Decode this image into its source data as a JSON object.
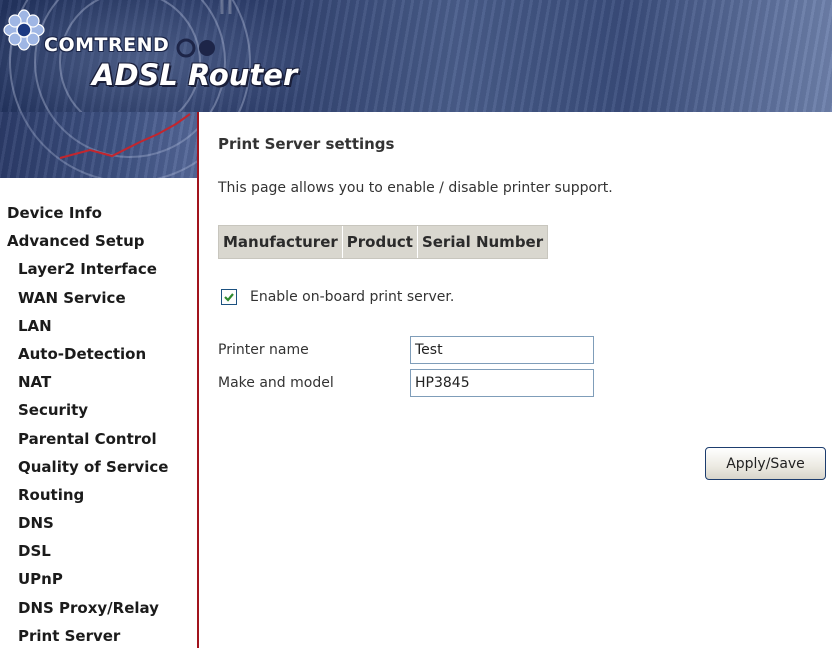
{
  "header": {
    "brand": "COMTREND",
    "product_title": "ADSL Router"
  },
  "colors": {
    "banner": "#2e3f6d",
    "divider": "#a1141d",
    "table_header_bg": "#d9d7cf"
  },
  "nav": {
    "items": [
      {
        "label": "Device Info",
        "level": "top"
      },
      {
        "label": "Advanced Setup",
        "level": "top"
      },
      {
        "label": "Layer2 Interface",
        "level": "sub"
      },
      {
        "label": "WAN Service",
        "level": "sub"
      },
      {
        "label": "LAN",
        "level": "sub"
      },
      {
        "label": "Auto-Detection",
        "level": "sub"
      },
      {
        "label": "NAT",
        "level": "sub"
      },
      {
        "label": "Security",
        "level": "sub"
      },
      {
        "label": "Parental Control",
        "level": "sub"
      },
      {
        "label": "Quality of Service",
        "level": "sub"
      },
      {
        "label": "Routing",
        "level": "sub"
      },
      {
        "label": "DNS",
        "level": "sub"
      },
      {
        "label": "DSL",
        "level": "sub"
      },
      {
        "label": "UPnP",
        "level": "sub"
      },
      {
        "label": "DNS Proxy/Relay",
        "level": "sub"
      },
      {
        "label": "Print Server",
        "level": "sub"
      }
    ]
  },
  "main": {
    "title": "Print Server settings",
    "description": "This page allows you to enable / disable printer support.",
    "table": {
      "columns": [
        "Manufacturer",
        "Product",
        "Serial Number"
      ]
    },
    "enable": {
      "label": "Enable on-board print server.",
      "checked": true
    },
    "printer_name": {
      "label": "Printer name",
      "value": "Test"
    },
    "make_model": {
      "label": "Make and model",
      "value": "HP3845"
    },
    "apply_label": "Apply/Save"
  }
}
